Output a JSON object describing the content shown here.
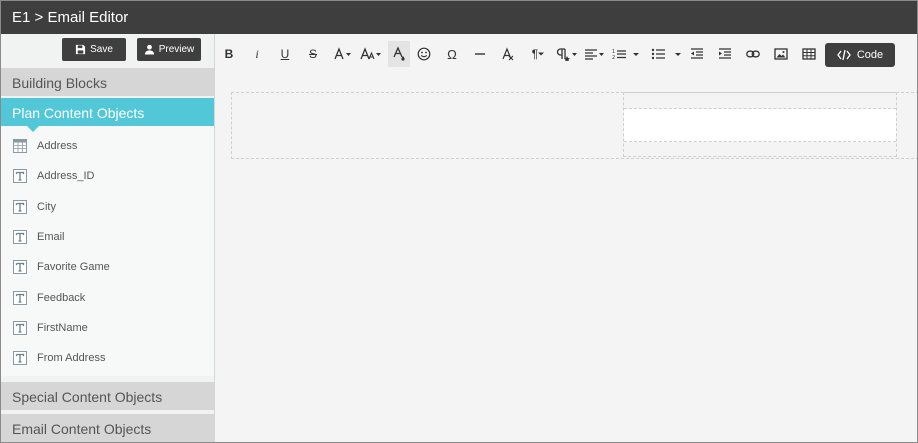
{
  "window": {
    "title": "E1 > Email Editor"
  },
  "sidebar": {
    "save_label": "Save",
    "preview_label": "Preview",
    "sections": {
      "building_blocks": "Building Blocks",
      "plan_content_objects": "Plan Content Objects",
      "special_content_objects": "Special Content Objects",
      "email_content_objects": "Email Content Objects"
    },
    "plan_objects": [
      {
        "label": "Address",
        "icon": "table-icon"
      },
      {
        "label": "Address_ID",
        "icon": "text-icon"
      },
      {
        "label": "City",
        "icon": "text-icon"
      },
      {
        "label": "Email",
        "icon": "text-icon"
      },
      {
        "label": "Favorite Game",
        "icon": "text-icon"
      },
      {
        "label": "Feedback",
        "icon": "text-icon"
      },
      {
        "label": "FirstName",
        "icon": "text-icon"
      },
      {
        "label": "From Address",
        "icon": "text-icon"
      }
    ]
  },
  "toolbar": {
    "code_label": "Code",
    "tools": [
      "bold",
      "italic",
      "underline",
      "strikethrough",
      "font-size",
      "font-family",
      "text-color",
      "emoticons",
      "special-characters",
      "horizontal-line",
      "clear-formatting",
      "paragraph-format",
      "paragraph-style",
      "align",
      "ordered-list",
      "unordered-list",
      "outdent",
      "indent",
      "insert-link",
      "insert-image",
      "insert-table"
    ],
    "bold_label": "B",
    "italic_label": "i",
    "underline_label": "U",
    "strike_label": "S",
    "omega_label": "Ω",
    "pilcrow_label": "¶"
  },
  "colors": {
    "titlebar": "#3e3e3e",
    "accent": "#52c7d8",
    "section": "#d6d6d6",
    "dark_button": "#3f3f3f"
  }
}
